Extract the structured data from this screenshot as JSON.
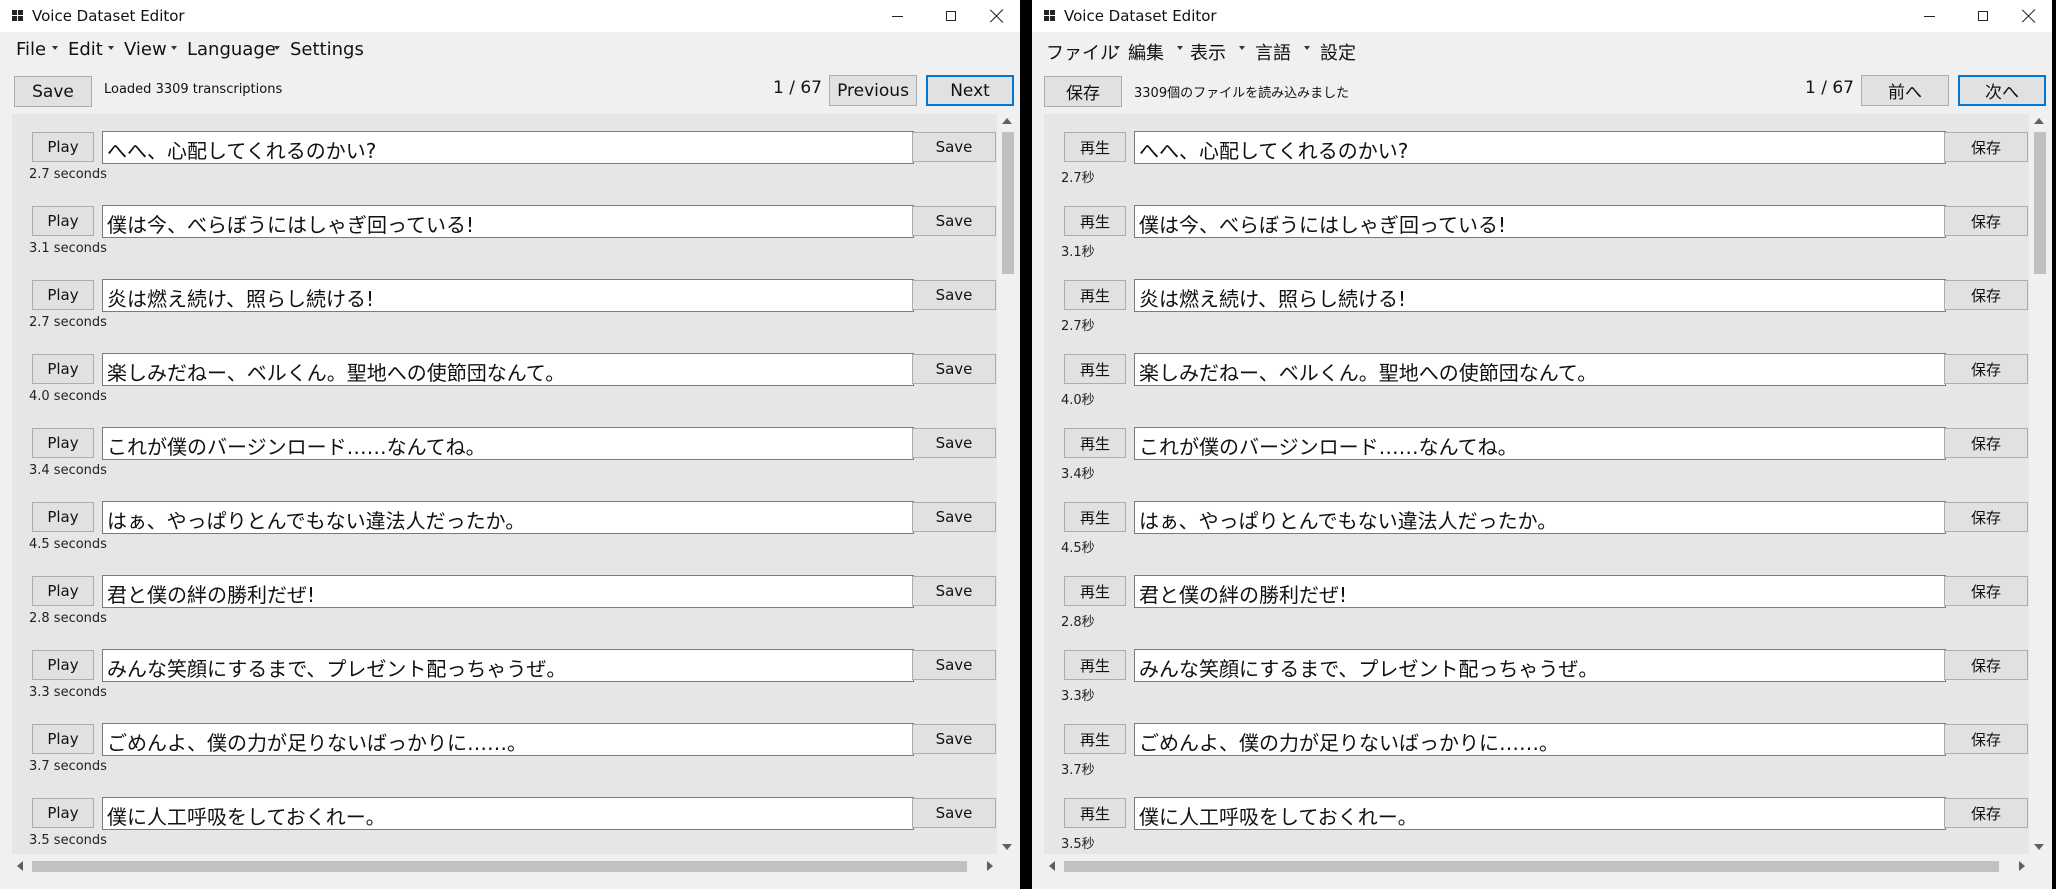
{
  "window_en": {
    "title": "Voice Dataset Editor",
    "menu": [
      {
        "label": "File",
        "has_arrow": true
      },
      {
        "label": "Edit",
        "has_arrow": true
      },
      {
        "label": "View",
        "has_arrow": true
      },
      {
        "label": "Language",
        "has_arrow": true
      },
      {
        "label": "Settings",
        "has_arrow": false
      }
    ],
    "toolbar": {
      "save_label": "Save",
      "status": "Loaded 3309 transcriptions",
      "page": "1 / 67",
      "previous_label": "Previous",
      "next_label": "Next"
    },
    "play_label": "Play",
    "save_label": "Save",
    "rows": [
      {
        "text": "へへ、心配してくれるのかい?",
        "duration": "2.7 seconds"
      },
      {
        "text": "僕は今、べらぼうにはしゃぎ回っている!",
        "duration": "3.1 seconds"
      },
      {
        "text": "炎は燃え続け、照らし続ける!",
        "duration": "2.7 seconds"
      },
      {
        "text": "楽しみだねー、ベルくん。聖地への使節団なんて。",
        "duration": "4.0 seconds"
      },
      {
        "text": "これが僕のバージンロード……なんてね。",
        "duration": "3.4 seconds"
      },
      {
        "text": "はぁ、やっぱりとんでもない違法人だったか。",
        "duration": "4.5 seconds"
      },
      {
        "text": "君と僕の絆の勝利だぜ!",
        "duration": "2.8 seconds"
      },
      {
        "text": "みんな笑顔にするまで、プレゼント配っちゃうぜ。",
        "duration": "3.3 seconds"
      },
      {
        "text": "ごめんよ、僕の力が足りないばっかりに……。",
        "duration": "3.7 seconds"
      },
      {
        "text": "僕に人工呼吸をしておくれー。",
        "duration": "3.5 seconds"
      }
    ]
  },
  "window_ja": {
    "title": "Voice Dataset Editor",
    "menu": [
      {
        "label": "ファイル",
        "has_arrow": true
      },
      {
        "label": "編集",
        "has_arrow": true
      },
      {
        "label": "表示",
        "has_arrow": true
      },
      {
        "label": "言語",
        "has_arrow": true
      },
      {
        "label": "設定",
        "has_arrow": false
      }
    ],
    "toolbar": {
      "save_label": "保存",
      "status": "3309個のファイルを読み込みました",
      "page": "1 / 67",
      "previous_label": "前へ",
      "next_label": "次へ"
    },
    "play_label": "再生",
    "save_label": "保存",
    "rows": [
      {
        "text": "へへ、心配してくれるのかい?",
        "duration": "2.7秒"
      },
      {
        "text": "僕は今、べらぼうにはしゃぎ回っている!",
        "duration": "3.1秒"
      },
      {
        "text": "炎は燃え続け、照らし続ける!",
        "duration": "2.7秒"
      },
      {
        "text": "楽しみだねー、ベルくん。聖地への使節団なんて。",
        "duration": "4.0秒"
      },
      {
        "text": "これが僕のバージンロード……なんてね。",
        "duration": "3.4秒"
      },
      {
        "text": "はぁ、やっぱりとんでもない違法人だったか。",
        "duration": "4.5秒"
      },
      {
        "text": "君と僕の絆の勝利だぜ!",
        "duration": "2.8秒"
      },
      {
        "text": "みんな笑顔にするまで、プレゼント配っちゃうぜ。",
        "duration": "3.3秒"
      },
      {
        "text": "ごめんよ、僕の力が足りないばっかりに……。",
        "duration": "3.7秒"
      },
      {
        "text": "僕に人工呼吸をしておくれー。",
        "duration": "3.5秒"
      }
    ]
  },
  "colors": {
    "accent": "#0078d7",
    "window_bg": "#f0f0f0",
    "list_bg": "#e6e6e6",
    "button_bg": "#e1e1e1"
  }
}
